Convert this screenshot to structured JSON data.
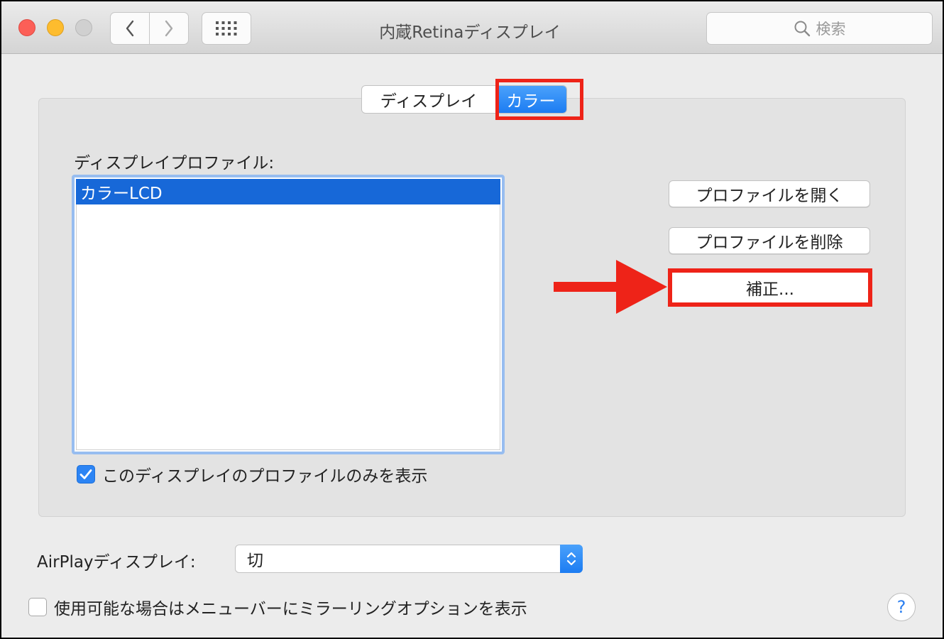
{
  "window": {
    "title": "内蔵Retinaディスプレイ",
    "search_placeholder": "検索"
  },
  "tabs": [
    {
      "label": "ディスプレイ",
      "selected": false
    },
    {
      "label": "カラー",
      "selected": true
    }
  ],
  "profiles": {
    "label": "ディスプレイプロファイル:",
    "items": [
      {
        "label": "カラーLCD",
        "selected": true
      }
    ],
    "only_this_display": {
      "label": "このディスプレイのプロファイルのみを表示",
      "checked": true
    }
  },
  "actions": {
    "open_profile": "プロファイルを開く",
    "delete_profile": "プロファイルを削除",
    "calibrate": "補正..."
  },
  "airplay": {
    "label": "AirPlayディスプレイ:",
    "value": "切"
  },
  "mirroring": {
    "label": "使用可能な場合はメニューバーにミラーリングオプションを表示",
    "checked": false
  },
  "help": {
    "label": "?"
  },
  "colors": {
    "accent": "#1c7cf2",
    "selection": "#1768d8",
    "annotation": "#ee2318"
  }
}
